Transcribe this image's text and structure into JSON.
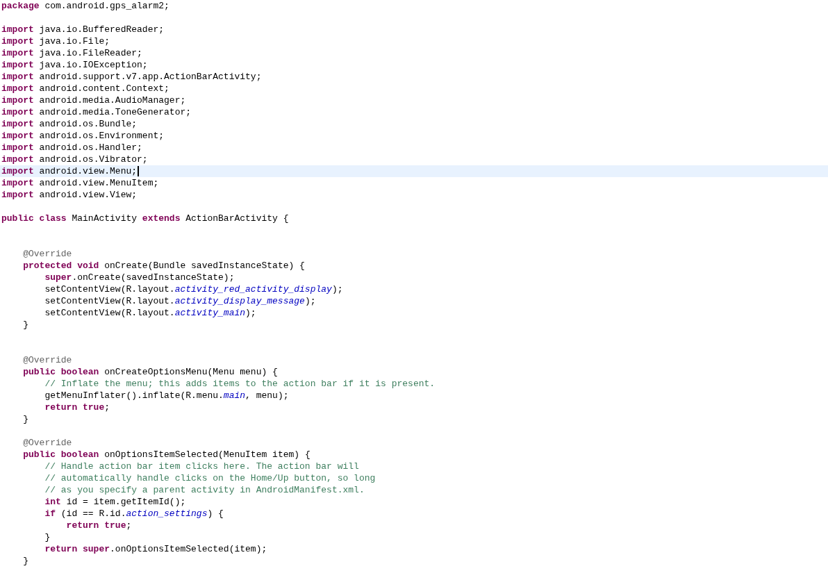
{
  "editor": {
    "lines": [
      {
        "current": false,
        "tokens": [
          {
            "kind": "keyword",
            "text": "package"
          },
          {
            "kind": "plain",
            "text": " com.android.gps_alarm2;"
          }
        ]
      },
      {
        "current": false
      },
      {
        "current": false,
        "tokens": [
          {
            "kind": "keyword",
            "text": "import"
          },
          {
            "kind": "plain",
            "text": " java.io.BufferedReader;"
          }
        ]
      },
      {
        "current": false,
        "tokens": [
          {
            "kind": "keyword",
            "text": "import"
          },
          {
            "kind": "plain",
            "text": " java.io.File;"
          }
        ]
      },
      {
        "current": false,
        "tokens": [
          {
            "kind": "keyword",
            "text": "import"
          },
          {
            "kind": "plain",
            "text": " java.io.FileReader;"
          }
        ]
      },
      {
        "current": false,
        "tokens": [
          {
            "kind": "keyword",
            "text": "import"
          },
          {
            "kind": "plain",
            "text": " java.io.IOException;"
          }
        ]
      },
      {
        "current": false,
        "tokens": [
          {
            "kind": "keyword",
            "text": "import"
          },
          {
            "kind": "plain",
            "text": " android.support.v7.app.ActionBarActivity;"
          }
        ]
      },
      {
        "current": false,
        "tokens": [
          {
            "kind": "keyword",
            "text": "import"
          },
          {
            "kind": "plain",
            "text": " android.content.Context;"
          }
        ]
      },
      {
        "current": false,
        "tokens": [
          {
            "kind": "keyword",
            "text": "import"
          },
          {
            "kind": "plain",
            "text": " android.media.AudioManager;"
          }
        ]
      },
      {
        "current": false,
        "tokens": [
          {
            "kind": "keyword",
            "text": "import"
          },
          {
            "kind": "plain",
            "text": " android.media.ToneGenerator;"
          }
        ]
      },
      {
        "current": false,
        "tokens": [
          {
            "kind": "keyword",
            "text": "import"
          },
          {
            "kind": "plain",
            "text": " android.os.Bundle;"
          }
        ]
      },
      {
        "current": false,
        "tokens": [
          {
            "kind": "keyword",
            "text": "import"
          },
          {
            "kind": "plain",
            "text": " android.os.Environment;"
          }
        ]
      },
      {
        "current": false,
        "tokens": [
          {
            "kind": "keyword",
            "text": "import"
          },
          {
            "kind": "plain",
            "text": " android.os.Handler;"
          }
        ]
      },
      {
        "current": false,
        "tokens": [
          {
            "kind": "keyword",
            "text": "import"
          },
          {
            "kind": "plain",
            "text": " android.os.Vibrator;"
          }
        ]
      },
      {
        "current": true,
        "tokens": [
          {
            "kind": "keyword",
            "text": "import"
          },
          {
            "kind": "plain",
            "text": " android.view.Menu;"
          }
        ]
      },
      {
        "current": false,
        "tokens": [
          {
            "kind": "keyword",
            "text": "import"
          },
          {
            "kind": "plain",
            "text": " android.view.MenuItem;"
          }
        ]
      },
      {
        "current": false,
        "tokens": [
          {
            "kind": "keyword",
            "text": "import"
          },
          {
            "kind": "plain",
            "text": " android.view.View;"
          }
        ]
      },
      {
        "current": false
      },
      {
        "current": false,
        "tokens": [
          {
            "kind": "keyword",
            "text": "public class"
          },
          {
            "kind": "plain",
            "text": " MainActivity "
          },
          {
            "kind": "keyword",
            "text": "extends"
          },
          {
            "kind": "plain",
            "text": " ActionBarActivity {"
          }
        ]
      },
      {
        "current": false
      },
      {
        "current": false
      },
      {
        "current": false,
        "tokens": [
          {
            "kind": "annotation",
            "text": "    @Override"
          }
        ]
      },
      {
        "current": false,
        "tokens": [
          {
            "kind": "keyword",
            "text": "    protected void"
          },
          {
            "kind": "plain",
            "text": " onCreate(Bundle savedInstanceState) {"
          }
        ]
      },
      {
        "current": false,
        "tokens": [
          {
            "kind": "keyword",
            "text": "        super"
          },
          {
            "kind": "plain",
            "text": ".onCreate(savedInstanceState);"
          }
        ]
      },
      {
        "current": false,
        "tokens": [
          {
            "kind": "plain",
            "text": "        setContentView(R.layout."
          },
          {
            "kind": "field",
            "text": "activity_red_activity_display"
          },
          {
            "kind": "plain",
            "text": ");"
          }
        ]
      },
      {
        "current": false,
        "tokens": [
          {
            "kind": "plain",
            "text": "        setContentView(R.layout."
          },
          {
            "kind": "field",
            "text": "activity_display_message"
          },
          {
            "kind": "plain",
            "text": ");"
          }
        ]
      },
      {
        "current": false,
        "tokens": [
          {
            "kind": "plain",
            "text": "        setContentView(R.layout."
          },
          {
            "kind": "field",
            "text": "activity_main"
          },
          {
            "kind": "plain",
            "text": ");"
          }
        ]
      },
      {
        "current": false,
        "tokens": [
          {
            "kind": "plain",
            "text": "    }"
          }
        ]
      },
      {
        "current": false
      },
      {
        "current": false
      },
      {
        "current": false,
        "tokens": [
          {
            "kind": "annotation",
            "text": "    @Override"
          }
        ]
      },
      {
        "current": false,
        "tokens": [
          {
            "kind": "keyword",
            "text": "    public boolean"
          },
          {
            "kind": "plain",
            "text": " onCreateOptionsMenu(Menu menu) {"
          }
        ]
      },
      {
        "current": false,
        "tokens": [
          {
            "kind": "comment",
            "text": "        // Inflate the menu; this adds items to the action bar if it is present."
          }
        ]
      },
      {
        "current": false,
        "tokens": [
          {
            "kind": "plain",
            "text": "        getMenuInflater().inflate(R.menu."
          },
          {
            "kind": "field",
            "text": "main"
          },
          {
            "kind": "plain",
            "text": ", menu);"
          }
        ]
      },
      {
        "current": false,
        "tokens": [
          {
            "kind": "keyword",
            "text": "        return true"
          },
          {
            "kind": "plain",
            "text": ";"
          }
        ]
      },
      {
        "current": false,
        "tokens": [
          {
            "kind": "plain",
            "text": "    }"
          }
        ]
      },
      {
        "current": false
      },
      {
        "current": false,
        "tokens": [
          {
            "kind": "annotation",
            "text": "    @Override"
          }
        ]
      },
      {
        "current": false,
        "tokens": [
          {
            "kind": "keyword",
            "text": "    public boolean"
          },
          {
            "kind": "plain",
            "text": " onOptionsItemSelected(MenuItem item) {"
          }
        ]
      },
      {
        "current": false,
        "tokens": [
          {
            "kind": "comment",
            "text": "        // Handle action bar item clicks here. The action bar will"
          }
        ]
      },
      {
        "current": false,
        "tokens": [
          {
            "kind": "comment",
            "text": "        // automatically handle clicks on the Home/Up button, so long"
          }
        ]
      },
      {
        "current": false,
        "tokens": [
          {
            "kind": "comment",
            "text": "        // as you specify a parent activity in AndroidManifest.xml."
          }
        ]
      },
      {
        "current": false,
        "tokens": [
          {
            "kind": "keyword",
            "text": "        int"
          },
          {
            "kind": "plain",
            "text": " id = item.getItemId();"
          }
        ]
      },
      {
        "current": false,
        "tokens": [
          {
            "kind": "keyword",
            "text": "        if"
          },
          {
            "kind": "plain",
            "text": " (id == R.id."
          },
          {
            "kind": "field",
            "text": "action_settings"
          },
          {
            "kind": "plain",
            "text": ") {"
          }
        ]
      },
      {
        "current": false,
        "tokens": [
          {
            "kind": "keyword",
            "text": "            return true"
          },
          {
            "kind": "plain",
            "text": ";"
          }
        ]
      },
      {
        "current": false,
        "tokens": [
          {
            "kind": "plain",
            "text": "        }"
          }
        ]
      },
      {
        "current": false,
        "tokens": [
          {
            "kind": "keyword",
            "text": "        return super"
          },
          {
            "kind": "plain",
            "text": ".onOptionsItemSelected(item);"
          }
        ]
      },
      {
        "current": false,
        "tokens": [
          {
            "kind": "plain",
            "text": "    }"
          }
        ]
      }
    ]
  }
}
